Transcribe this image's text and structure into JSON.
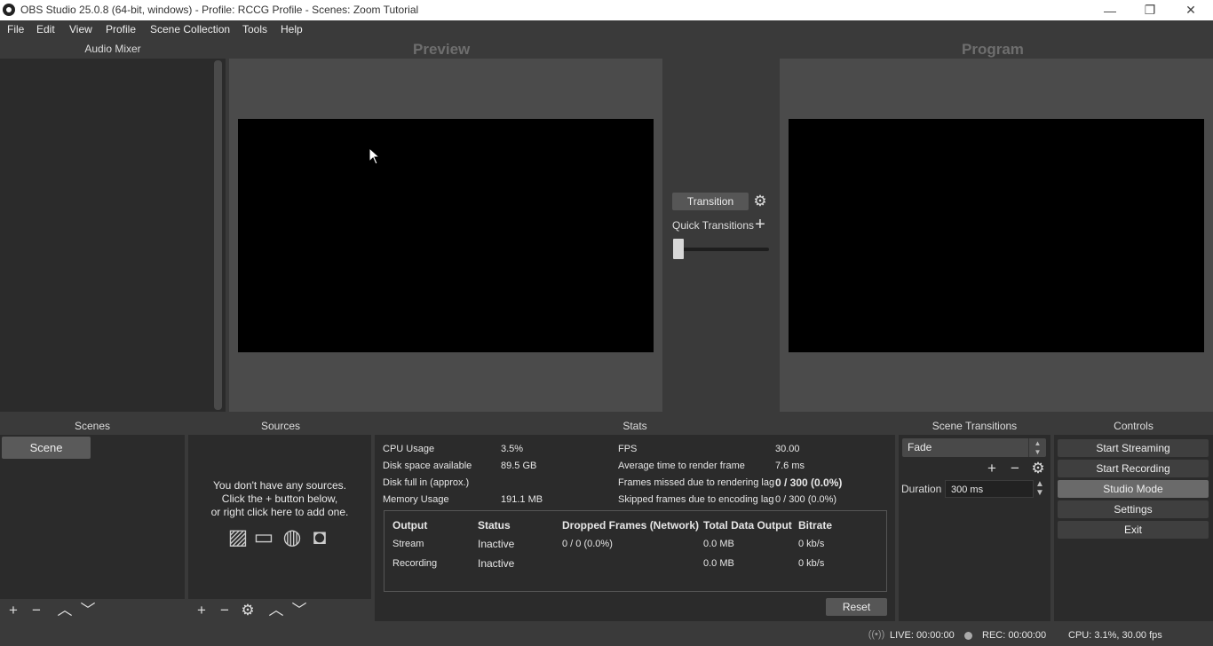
{
  "window": {
    "title": "OBS Studio 25.0.8 (64-bit, windows) - Profile: RCCG Profile - Scenes: Zoom Tutorial",
    "minimize_glyph": "—",
    "restore_glyph": "❐",
    "close_glyph": "✕"
  },
  "menu": [
    "File",
    "Edit",
    "View",
    "Profile",
    "Scene Collection",
    "Tools",
    "Help"
  ],
  "audio_mixer": {
    "title": "Audio Mixer"
  },
  "preview": {
    "label": "Preview"
  },
  "program": {
    "label": "Program"
  },
  "transition": {
    "button_label": "Transition",
    "quick_transitions_label": "Quick Transitions",
    "gear_icon": "gear-icon",
    "add_icon": "plus-icon",
    "tbar_position": 0.0
  },
  "scenes": {
    "title": "Scenes",
    "items": [
      "Scene"
    ]
  },
  "sources": {
    "title": "Sources",
    "empty_line1": "You don't have any sources.",
    "empty_line2": "Click the + button below,",
    "empty_line3": "or right click here to add one."
  },
  "stats": {
    "title": "Stats",
    "left": [
      {
        "label": "CPU Usage",
        "value": "3.5%"
      },
      {
        "label": "Disk space available",
        "value": "89.5 GB"
      },
      {
        "label": "Disk full in (approx.)",
        "value": ""
      },
      {
        "label": "Memory Usage",
        "value": "191.1 MB"
      }
    ],
    "right": [
      {
        "label": "FPS",
        "value": "30.00"
      },
      {
        "label": "Average time to render frame",
        "value": "7.6 ms"
      },
      {
        "label": "Frames missed due to rendering lag",
        "value": "0 / 300 (0.0%)"
      },
      {
        "label": "Skipped frames due to encoding lag",
        "value": "0 / 300 (0.0%)"
      }
    ],
    "output_headers": [
      "Output",
      "Status",
      "Dropped Frames (Network)",
      "Total Data Output",
      "Bitrate"
    ],
    "output_rows": [
      {
        "output": "Stream",
        "status": "Inactive",
        "dropped": "0 / 0 (0.0%)",
        "total": "0.0 MB",
        "bitrate": "0 kb/s"
      },
      {
        "output": "Recording",
        "status": "Inactive",
        "dropped": "",
        "total": "0.0 MB",
        "bitrate": "0 kb/s"
      }
    ],
    "reset_label": "Reset"
  },
  "scene_transitions": {
    "title": "Scene Transitions",
    "selected": "Fade",
    "duration_label": "Duration",
    "duration_value": "300 ms"
  },
  "controls": {
    "title": "Controls",
    "buttons": [
      "Start Streaming",
      "Start Recording",
      "Studio Mode",
      "Settings",
      "Exit"
    ],
    "active": "Studio Mode"
  },
  "status": {
    "live": "LIVE: 00:00:00",
    "rec": "REC: 00:00:00",
    "cpu": "CPU: 3.1%, 30.00 fps"
  }
}
